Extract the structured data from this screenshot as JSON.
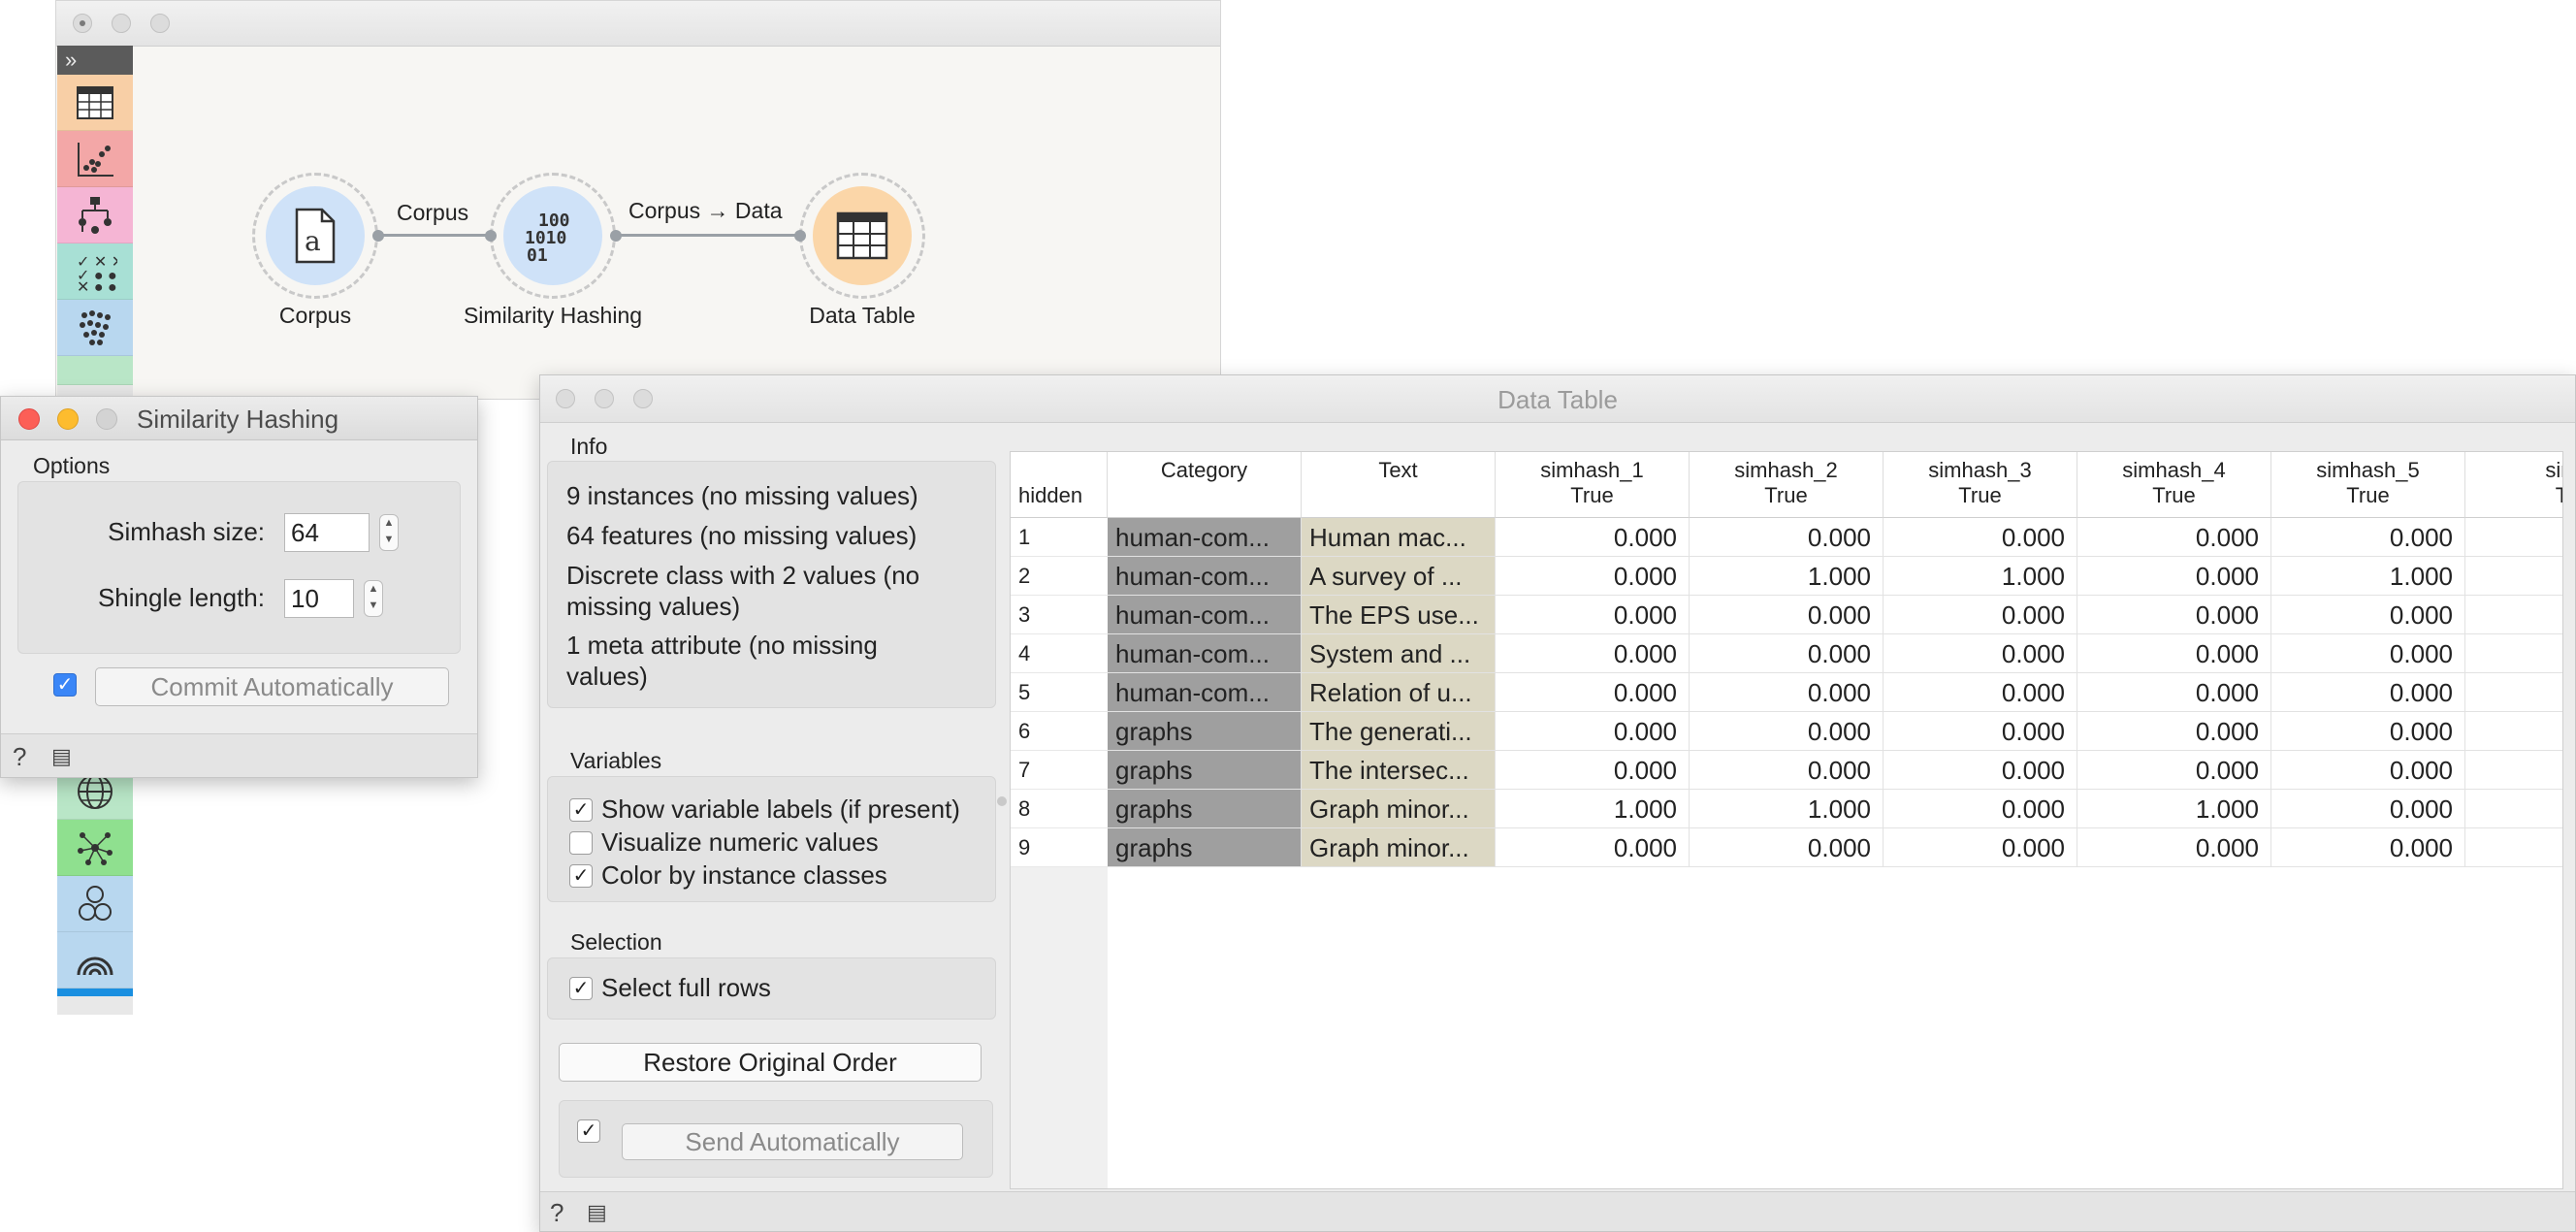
{
  "canvas": {
    "nodes": [
      {
        "name": "Corpus"
      },
      {
        "name": "Similarity Hashing"
      },
      {
        "name": "Data Table"
      }
    ],
    "links": [
      {
        "label": "Corpus"
      },
      {
        "label": "Corpus → Data"
      }
    ],
    "toolbox_icons": [
      "table-icon",
      "scatter-icon",
      "tree-icon",
      "checks-icon",
      "dots-cluster-icon",
      "globe-icon",
      "network-icon",
      "circles-icon",
      "rainbow-icon"
    ]
  },
  "similarity_hashing": {
    "title": "Similarity Hashing",
    "options_label": "Options",
    "simhash_label": "Simhash size:",
    "simhash_value": "64",
    "shingle_label": "Shingle length:",
    "shingle_value": "10",
    "commit_label": "Commit Automatically",
    "commit_checked": true
  },
  "data_table": {
    "title": "Data Table",
    "info_label": "Info",
    "info_lines": [
      "9 instances (no missing values)",
      "64 features (no missing values)",
      "Discrete class with 2 values (no",
      "missing values)",
      "1 meta attribute (no missing",
      "values)"
    ],
    "variables_label": "Variables",
    "show_labels": "Show variable labels (if present)",
    "visualize_numeric": "Visualize numeric values",
    "color_by_class": "Color by instance classes",
    "selection_label": "Selection",
    "select_rows": "Select full rows",
    "restore_btn": "Restore Original Order",
    "send_btn": "Send Automatically",
    "corner_label": "hidden",
    "columns": [
      {
        "name": "Category",
        "sub": ""
      },
      {
        "name": "Text",
        "sub": ""
      },
      {
        "name": "simhash_1",
        "sub": "True"
      },
      {
        "name": "simhash_2",
        "sub": "True"
      },
      {
        "name": "simhash_3",
        "sub": "True"
      },
      {
        "name": "simhash_4",
        "sub": "True"
      },
      {
        "name": "simhash_5",
        "sub": "True"
      },
      {
        "name": "sim",
        "sub": "T"
      }
    ],
    "rows": [
      {
        "n": "1",
        "cat": "human-com...",
        "text": "Human mac...",
        "v": [
          "0.000",
          "0.000",
          "0.000",
          "0.000",
          "0.000"
        ]
      },
      {
        "n": "2",
        "cat": "human-com...",
        "text": "A survey of ...",
        "v": [
          "0.000",
          "1.000",
          "1.000",
          "0.000",
          "1.000"
        ]
      },
      {
        "n": "3",
        "cat": "human-com...",
        "text": "The EPS use...",
        "v": [
          "0.000",
          "0.000",
          "0.000",
          "0.000",
          "0.000"
        ]
      },
      {
        "n": "4",
        "cat": "human-com...",
        "text": "System and ...",
        "v": [
          "0.000",
          "0.000",
          "0.000",
          "0.000",
          "0.000"
        ]
      },
      {
        "n": "5",
        "cat": "human-com...",
        "text": "Relation of u...",
        "v": [
          "0.000",
          "0.000",
          "0.000",
          "0.000",
          "0.000"
        ]
      },
      {
        "n": "6",
        "cat": "graphs",
        "text": "The generati...",
        "v": [
          "0.000",
          "0.000",
          "0.000",
          "0.000",
          "0.000"
        ]
      },
      {
        "n": "7",
        "cat": "graphs",
        "text": "The intersec...",
        "v": [
          "0.000",
          "0.000",
          "0.000",
          "0.000",
          "0.000"
        ]
      },
      {
        "n": "8",
        "cat": "graphs",
        "text": "Graph minor...",
        "v": [
          "1.000",
          "1.000",
          "0.000",
          "1.000",
          "0.000"
        ]
      },
      {
        "n": "9",
        "cat": "graphs",
        "text": "Graph minor...",
        "v": [
          "0.000",
          "0.000",
          "0.000",
          "0.000",
          "0.000"
        ]
      }
    ]
  }
}
